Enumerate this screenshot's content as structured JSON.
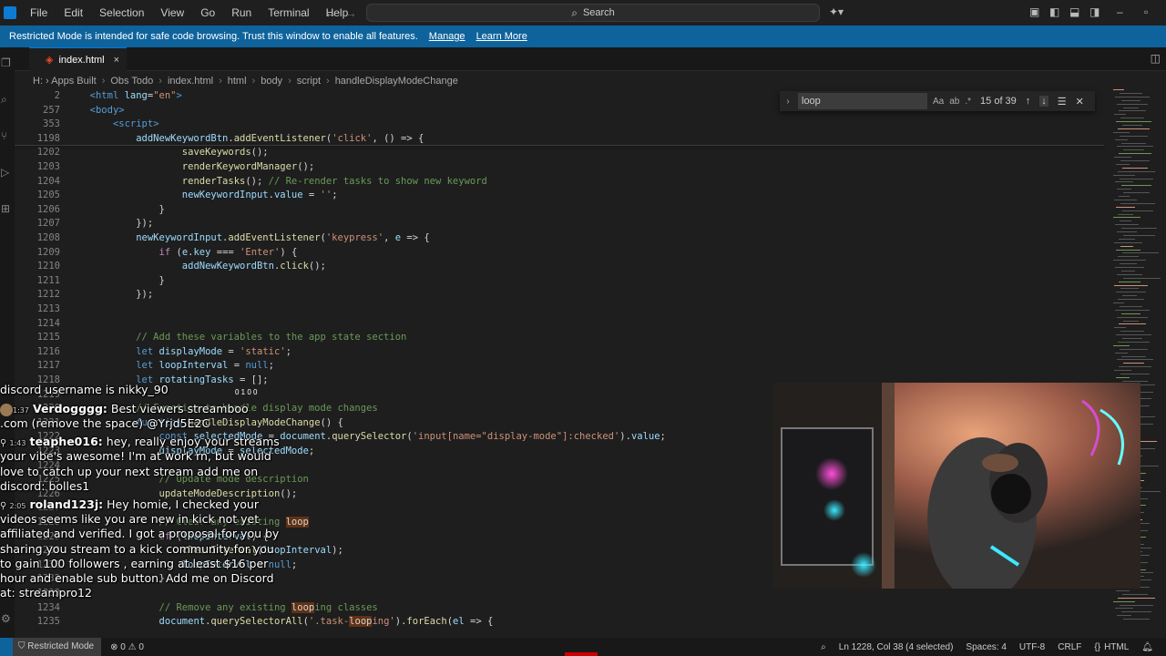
{
  "menu": [
    "File",
    "Edit",
    "Selection",
    "View",
    "Go",
    "Run",
    "Terminal",
    "Help"
  ],
  "search": {
    "label": "Search"
  },
  "banner": {
    "text": "Restricted Mode is intended for safe code browsing. Trust this window to enable all features.",
    "manage": "Manage",
    "learn_more": "Learn More"
  },
  "tab": {
    "label": "index.html",
    "close": "×"
  },
  "breadcrumb": [
    "H: › Apps Built",
    "Obs Todo",
    "index.html",
    "html",
    "body",
    "script",
    "handleDisplayModeChange"
  ],
  "find": {
    "query": "loop",
    "options": [
      "Aa",
      "ab",
      ".*"
    ],
    "count": "15 of 39"
  },
  "code_lines": [
    {
      "n": "2",
      "parts": [
        [
          "p",
          "  "
        ],
        [
          "t",
          "<html"
        ],
        [
          "a",
          " lang"
        ],
        [
          "p",
          "="
        ],
        [
          "s",
          "\"en\""
        ],
        [
          "t",
          ">"
        ]
      ]
    },
    {
      "n": "257",
      "parts": [
        [
          "p",
          "  "
        ],
        [
          "t",
          "<body>"
        ]
      ]
    },
    {
      "n": "353",
      "parts": [
        [
          "p",
          "      "
        ],
        [
          "t",
          "<script>"
        ]
      ]
    },
    {
      "n": "1198",
      "parts": [
        [
          "p",
          "          "
        ],
        [
          "v",
          "addNewKeywordBtn"
        ],
        [
          "p",
          "."
        ],
        [
          "f",
          "addEventListener"
        ],
        [
          "p",
          "("
        ],
        [
          "s",
          "'click'"
        ],
        [
          "p",
          ", () => {"
        ]
      ]
    },
    {
      "n": "1202",
      "parts": [
        [
          "p",
          "                  "
        ],
        [
          "f",
          "saveKeywords"
        ],
        [
          "p",
          "();"
        ]
      ]
    },
    {
      "n": "1203",
      "parts": [
        [
          "p",
          "                  "
        ],
        [
          "f",
          "renderKeywordManager"
        ],
        [
          "p",
          "();"
        ]
      ]
    },
    {
      "n": "1204",
      "parts": [
        [
          "p",
          "                  "
        ],
        [
          "f",
          "renderTasks"
        ],
        [
          "p",
          "(); "
        ],
        [
          "c",
          "// Re-render tasks to show new keyword"
        ]
      ]
    },
    {
      "n": "1205",
      "parts": [
        [
          "p",
          "                  "
        ],
        [
          "v",
          "newKeywordInput"
        ],
        [
          "p",
          "."
        ],
        [
          "v",
          "value"
        ],
        [
          "p",
          " = "
        ],
        [
          "s",
          "''"
        ],
        [
          "p",
          ";"
        ]
      ]
    },
    {
      "n": "1206",
      "parts": [
        [
          "p",
          "              }"
        ]
      ]
    },
    {
      "n": "1207",
      "parts": [
        [
          "p",
          "          });"
        ]
      ]
    },
    {
      "n": "1208",
      "parts": [
        [
          "p",
          "          "
        ],
        [
          "v",
          "newKeywordInput"
        ],
        [
          "p",
          "."
        ],
        [
          "f",
          "addEventListener"
        ],
        [
          "p",
          "("
        ],
        [
          "s",
          "'keypress'"
        ],
        [
          "p",
          ", "
        ],
        [
          "v",
          "e"
        ],
        [
          "p",
          " => {"
        ]
      ]
    },
    {
      "n": "1209",
      "parts": [
        [
          "p",
          "              "
        ],
        [
          "kc",
          "if"
        ],
        [
          "p",
          " ("
        ],
        [
          "v",
          "e"
        ],
        [
          "p",
          "."
        ],
        [
          "v",
          "key"
        ],
        [
          "p",
          " === "
        ],
        [
          "s",
          "'Enter'"
        ],
        [
          "p",
          ") {"
        ]
      ]
    },
    {
      "n": "1210",
      "parts": [
        [
          "p",
          "                  "
        ],
        [
          "v",
          "addNewKeywordBtn"
        ],
        [
          "p",
          "."
        ],
        [
          "f",
          "click"
        ],
        [
          "p",
          "();"
        ]
      ]
    },
    {
      "n": "1211",
      "parts": [
        [
          "p",
          "              }"
        ]
      ]
    },
    {
      "n": "1212",
      "parts": [
        [
          "p",
          "          });"
        ]
      ]
    },
    {
      "n": "1213",
      "parts": [
        [
          "p",
          ""
        ]
      ]
    },
    {
      "n": "1214",
      "parts": [
        [
          "p",
          ""
        ]
      ]
    },
    {
      "n": "1215",
      "parts": [
        [
          "p",
          "          "
        ],
        [
          "c",
          "// Add these variables to the app state section"
        ]
      ]
    },
    {
      "n": "1216",
      "parts": [
        [
          "p",
          "          "
        ],
        [
          "k",
          "let"
        ],
        [
          "p",
          " "
        ],
        [
          "v",
          "displayMode"
        ],
        [
          "p",
          " = "
        ],
        [
          "s",
          "'static'"
        ],
        [
          "p",
          ";"
        ]
      ]
    },
    {
      "n": "1217",
      "parts": [
        [
          "p",
          "          "
        ],
        [
          "k",
          "let"
        ],
        [
          "p",
          " "
        ],
        [
          "v",
          "loopInterval"
        ],
        [
          "p",
          " = "
        ],
        [
          "k",
          "null"
        ],
        [
          "p",
          ";"
        ]
      ]
    },
    {
      "n": "1218",
      "parts": [
        [
          "p",
          "          "
        ],
        [
          "k",
          "let"
        ],
        [
          "p",
          " "
        ],
        [
          "v",
          "rotatingTasks"
        ],
        [
          "p",
          " = [];"
        ]
      ]
    },
    {
      "n": "1219",
      "parts": [
        [
          "p",
          ""
        ]
      ]
    },
    {
      "n": "1220",
      "parts": [
        [
          "p",
          "          "
        ],
        [
          "c",
          "// Function to handle display mode changes"
        ]
      ]
    },
    {
      "n": "1221",
      "parts": [
        [
          "p",
          "          "
        ],
        [
          "k",
          "function"
        ],
        [
          "p",
          " "
        ],
        [
          "f",
          "handleDisplayModeChange"
        ],
        [
          "p",
          "() {"
        ]
      ]
    },
    {
      "n": "1222",
      "parts": [
        [
          "p",
          "              "
        ],
        [
          "k",
          "const"
        ],
        [
          "p",
          " "
        ],
        [
          "v",
          "selectedMode"
        ],
        [
          "p",
          " = "
        ],
        [
          "v",
          "document"
        ],
        [
          "p",
          "."
        ],
        [
          "f",
          "querySelector"
        ],
        [
          "p",
          "("
        ],
        [
          "s",
          "'input[name=\"display-mode\"]:checked'"
        ],
        [
          "p",
          ")."
        ],
        [
          "v",
          "value"
        ],
        [
          "p",
          ";"
        ]
      ]
    },
    {
      "n": "1223",
      "parts": [
        [
          "p",
          "              "
        ],
        [
          "v",
          "displayMode"
        ],
        [
          "p",
          " = "
        ],
        [
          "v",
          "selectedMode"
        ],
        [
          "p",
          ";"
        ]
      ]
    },
    {
      "n": "1224",
      "parts": [
        [
          "p",
          ""
        ]
      ]
    },
    {
      "n": "1225",
      "parts": [
        [
          "p",
          "              "
        ],
        [
          "c",
          "// Update mode description"
        ]
      ]
    },
    {
      "n": "1226",
      "parts": [
        [
          "p",
          "              "
        ],
        [
          "f",
          "updateModeDescription"
        ],
        [
          "p",
          "();"
        ]
      ]
    },
    {
      "n": "1227",
      "parts": [
        [
          "p",
          ""
        ]
      ]
    },
    {
      "n": "1228",
      "parts": [
        [
          "p",
          "              "
        ],
        [
          "c",
          "// Clear any existing "
        ],
        [
          "hl",
          "loop"
        ]
      ]
    },
    {
      "n": "1229",
      "parts": [
        [
          "p",
          "              "
        ],
        [
          "kc",
          "if"
        ],
        [
          "p",
          " ("
        ],
        [
          "v",
          "loopInterval"
        ],
        [
          "p",
          ") {"
        ]
      ]
    },
    {
      "n": "1230",
      "parts": [
        [
          "p",
          "                  "
        ],
        [
          "f",
          "clearInterval"
        ],
        [
          "p",
          "("
        ],
        [
          "v",
          "loopInterval"
        ],
        [
          "p",
          ");"
        ]
      ]
    },
    {
      "n": "1231",
      "parts": [
        [
          "p",
          "                  "
        ],
        [
          "v",
          "loopInterval"
        ],
        [
          "p",
          " = "
        ],
        [
          "k",
          "null"
        ],
        [
          "p",
          ";"
        ]
      ]
    },
    {
      "n": "1232",
      "parts": [
        [
          "p",
          "              }"
        ]
      ]
    },
    {
      "n": "1233",
      "parts": [
        [
          "p",
          ""
        ]
      ]
    },
    {
      "n": "1234",
      "parts": [
        [
          "p",
          "              "
        ],
        [
          "c",
          "// Remove any existing "
        ],
        [
          "hl",
          "loop"
        ],
        [
          "c",
          "ing classes"
        ]
      ]
    },
    {
      "n": "1235",
      "parts": [
        [
          "p",
          "              "
        ],
        [
          "v",
          "document"
        ],
        [
          "p",
          "."
        ],
        [
          "f",
          "querySelectorAll"
        ],
        [
          "p",
          "("
        ],
        [
          "s",
          "'.task-"
        ],
        [
          "hl",
          "loop"
        ],
        [
          "s",
          "ing'"
        ],
        [
          "p",
          ")."
        ],
        [
          "f",
          "forEach"
        ],
        [
          "p",
          "("
        ],
        [
          "v",
          "el"
        ],
        [
          "p",
          " => {"
        ]
      ]
    }
  ],
  "chat": {
    "header": "discord username is nikky_90",
    "messages": [
      {
        "time": "1:37",
        "user": "Verdogggg:",
        "lines": [
          "Best viewers streamboo",
          ".com (remove the space) @Yrjd5E2C"
        ]
      },
      {
        "time": "1:43",
        "user": "teaphe016:",
        "lines": [
          "hey, really enjoy your streams",
          "your vibe's awesome! I'm at work rn, but would",
          "love to catch up your next stream add me on",
          "discord: bolles1"
        ]
      },
      {
        "time": "2:05",
        "user": "roland123j:",
        "lines": [
          "Hey homie, I checked your",
          "videos seems like you are new in kick not yet",
          "affiliated and verified. I got a proposal for you by",
          "sharing you stream to a kick community for you",
          "to gain 100 followers , earning at least $16 per",
          "hour and enable sub button. Add me on Discord",
          "at: streampro12"
        ]
      }
    ],
    "badges": "0  1  0  0"
  },
  "status": {
    "mode": "Restricted Mode",
    "problems": "0",
    "warnings": "0",
    "position": "Ln 1228, Col 38 (4 selected)",
    "spaces": "Spaces: 4",
    "encoding": "UTF-8",
    "eol": "CRLF",
    "language": "HTML"
  }
}
